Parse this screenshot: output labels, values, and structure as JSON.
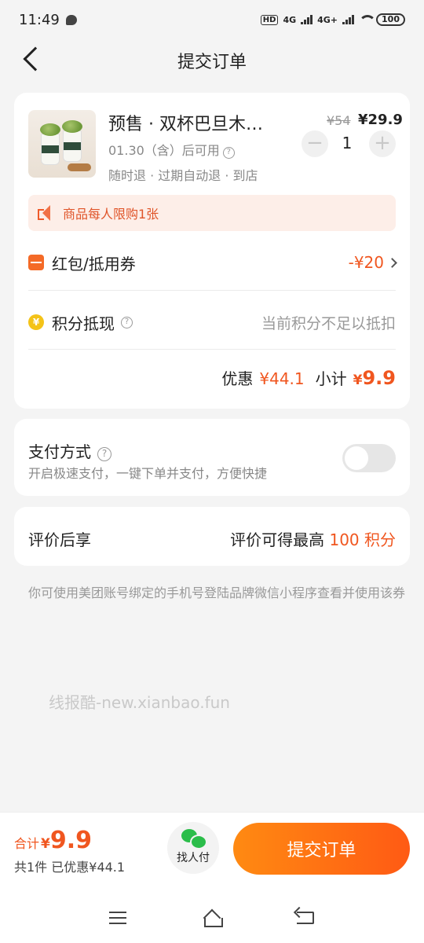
{
  "status": {
    "time": "11:49",
    "battery": "100",
    "net1": "4G",
    "net2": "4G+",
    "hd": "HD"
  },
  "header": {
    "title": "提交订单"
  },
  "product": {
    "title": "预售 · 双杯巴旦木…",
    "price_old": "¥54",
    "price_new": "¥29.9",
    "available": "01.30（含）后可用",
    "tags": "随时退 · 过期自动退 · 到店",
    "quantity": "1",
    "minus": "−",
    "plus": "+"
  },
  "notice": {
    "text": "商品每人限购1张"
  },
  "coupon": {
    "label": "红包/抵用券",
    "value": "-¥20"
  },
  "points": {
    "label": "积分抵现",
    "value": "当前积分不足以抵扣",
    "coin": "¥"
  },
  "summary": {
    "discount_label": "优惠",
    "discount_value": "¥44.1",
    "subtotal_label": "小计",
    "subtotal_yen": "¥",
    "subtotal_value": "9.9"
  },
  "payment": {
    "title": "支付方式",
    "desc": "开启极速支付，一键下单并支付，方便快捷",
    "toggle_on": false
  },
  "review": {
    "label": "评价后享",
    "value_prefix": "评价可得最高",
    "value_points": "100 积分"
  },
  "tip": "你可使用美团账号绑定的手机号登陆品牌微信小程序查看并使用该券",
  "watermark": "线报酷-new.xianbao.fun",
  "bottom": {
    "total_label": "合计",
    "total_yen": "¥",
    "total_amount": "9.9",
    "total_sub": "共1件  已优惠¥44.1",
    "share_label": "找人付",
    "submit_label": "提交订单"
  },
  "colors": {
    "accent": "#f0561f",
    "button_start": "#ff8a12",
    "button_end": "#ff5a14",
    "wechat": "#2bbd4a"
  }
}
